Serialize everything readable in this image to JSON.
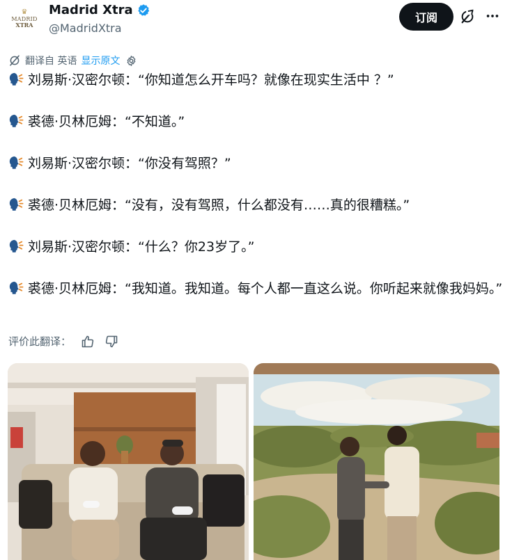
{
  "author": {
    "avatar_text": [
      "MADRID",
      "XTRA"
    ],
    "display_name": "Madrid Xtra",
    "handle": "@MadridXtra",
    "verified_color": "#1d9bf0"
  },
  "actions": {
    "subscribe_label": "订阅",
    "grok_icon": "grok-icon",
    "more_icon": "more-icon"
  },
  "translation": {
    "translated_from": "翻译自 英语",
    "show_original": "显示原文"
  },
  "lines": [
    {
      "speaker": "刘易斯·汉密尔顿：",
      "quote": "“你知道怎么开车吗？就像在现实生活中 ？”"
    },
    {
      "speaker": "裘德·贝林厄姆：",
      "quote": "“不知道。”"
    },
    {
      "speaker": "刘易斯·汉密尔顿：",
      "quote": "“你没有驾照？”"
    },
    {
      "speaker": "裘德·贝林厄姆：",
      "quote": "“没有，没有驾照，什么都没有……真的很糟糕。”"
    },
    {
      "speaker": "刘易斯·汉密尔顿：",
      "quote": "“什么？你23岁了。”"
    },
    {
      "speaker": "裘德·贝林厄姆：",
      "quote": "“我知道。我知道。每个人都一直这么说。你听起来就像我妈妈。”"
    }
  ],
  "rating": {
    "label": "评价此翻译：",
    "like_icon": "thumbs-up-icon",
    "dislike_icon": "thumbs-down-icon"
  },
  "colors": {
    "accent": "#1d9bf0",
    "text": "#0f1419",
    "muted": "#536471",
    "button": "#0f1419"
  }
}
